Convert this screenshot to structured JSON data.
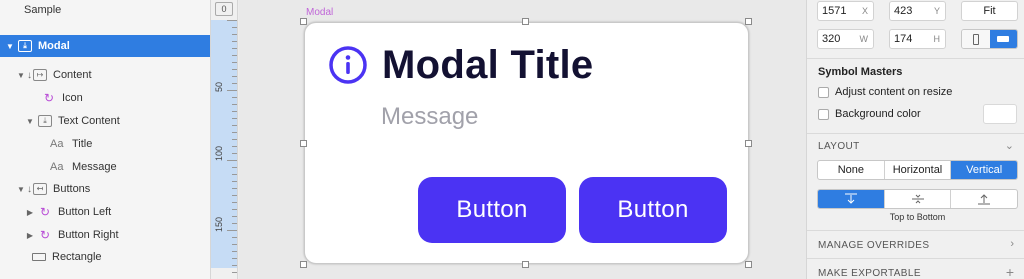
{
  "layers": {
    "page_name": "Sample",
    "items": [
      {
        "label": "Modal"
      },
      {
        "label": "Content"
      },
      {
        "label": "Icon"
      },
      {
        "label": "Text Content"
      },
      {
        "label": "Title",
        "type_glyph": "Aa"
      },
      {
        "label": "Message",
        "type_glyph": "Aa"
      },
      {
        "label": "Buttons"
      },
      {
        "label": "Button Left"
      },
      {
        "label": "Button Right"
      },
      {
        "label": "Rectangle"
      }
    ]
  },
  "ruler": {
    "zero": "0",
    "labels": [
      "50",
      "100",
      "150"
    ]
  },
  "canvas": {
    "artboard_label": "Modal",
    "modal": {
      "title": "Modal Title",
      "message": "Message",
      "button_left": "Button",
      "button_right": "Button"
    }
  },
  "inspector": {
    "x": {
      "value": "1571",
      "suffix": "X"
    },
    "y": {
      "value": "423",
      "suffix": "Y"
    },
    "w": {
      "value": "320",
      "suffix": "W"
    },
    "h": {
      "value": "174",
      "suffix": "H"
    },
    "fit_label": "Fit",
    "symbol_masters": {
      "title": "Symbol Masters",
      "adjust_label": "Adjust content on resize",
      "background_label": "Background color"
    },
    "layout": {
      "title": "LAYOUT",
      "options": [
        "None",
        "Horizontal",
        "Vertical"
      ],
      "selected": "Vertical",
      "direction_caption": "Top to Bottom"
    },
    "manage_overrides": "MANAGE OVERRIDES",
    "make_exportable": "MAKE EXPORTABLE"
  },
  "colors": {
    "accent": "#4b33f3",
    "selection": "#2f7de1",
    "title": "#131132",
    "message": "#a1a1aa",
    "symbol": "#b84bd6"
  }
}
